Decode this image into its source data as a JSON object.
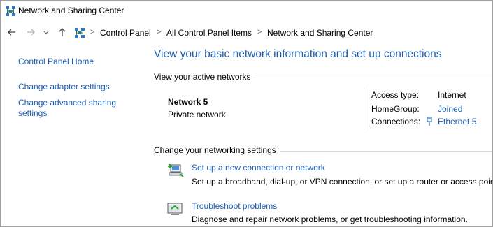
{
  "window": {
    "title": "Network and Sharing Center"
  },
  "nav": {
    "back_icon": "back-arrow-icon",
    "forward_icon": "forward-arrow-icon",
    "recent_icon": "chevron-down-icon",
    "up_icon": "up-arrow-icon"
  },
  "breadcrumb": {
    "sep": ">",
    "items": [
      "Control Panel",
      "All Control Panel Items",
      "Network and Sharing Center"
    ]
  },
  "sidebar": {
    "items": [
      {
        "label": "Control Panel Home"
      },
      {
        "label": "Change adapter settings"
      },
      {
        "label": "Change advanced sharing"
      },
      {
        "label": "settings"
      }
    ]
  },
  "main": {
    "title": "View your basic network information and set up connections",
    "active_networks_label": "View your active networks",
    "network": {
      "name": "Network  5",
      "category": "Private network",
      "access_type_label": "Access type:",
      "access_type_value": "Internet",
      "homegroup_label": "HomeGroup:",
      "homegroup_value": "Joined",
      "connections_label": "Connections:",
      "connections_value": "Ethernet 5"
    },
    "change_settings_label": "Change your networking settings",
    "tasks": [
      {
        "icon": "new-connection-icon",
        "link": "Set up a new connection or network",
        "desc": "Set up a broadband, dial-up, or VPN connection; or set up a router or access point."
      },
      {
        "icon": "troubleshoot-icon",
        "link": "Troubleshoot problems",
        "desc": "Diagnose and repair network problems, or get troubleshooting information."
      }
    ]
  },
  "colors": {
    "link": "#1a5fb4",
    "title": "#1f5da8",
    "separator": "#d9d9d9"
  }
}
